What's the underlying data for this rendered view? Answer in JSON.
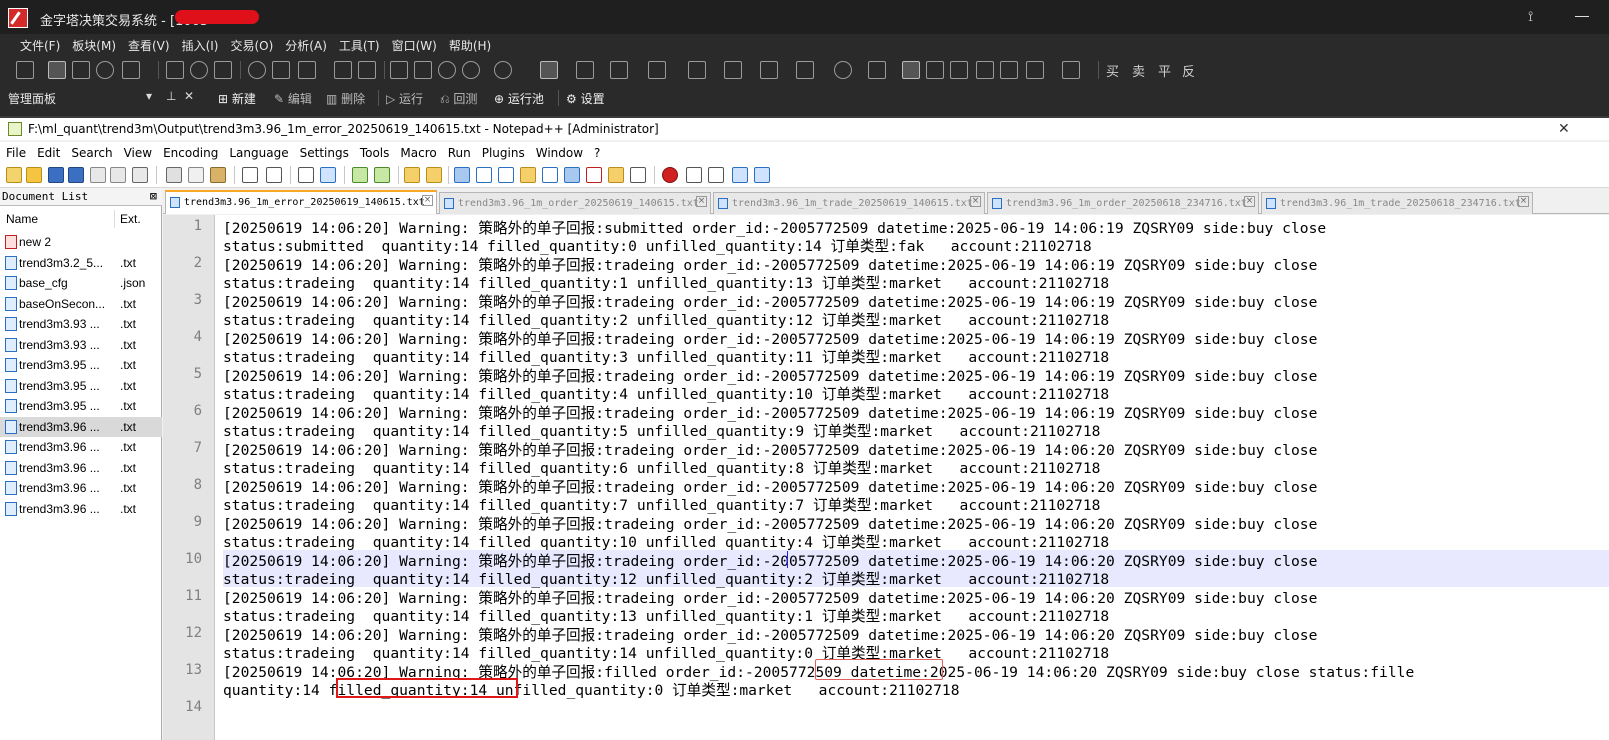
{
  "app": {
    "title": "金字塔决策交易系统 - [1063",
    "menu": [
      "文件(F)",
      "板块(M)",
      "查看(V)",
      "插入(I)",
      "交易(O)",
      "分析(A)",
      "工具(T)",
      "窗口(W)",
      "帮助(H)"
    ],
    "trade_buttons": [
      "买",
      "卖",
      "平",
      "反"
    ],
    "panel_title": "管理面板",
    "actions": {
      "new": "新建",
      "edit": "编辑",
      "delete": "删除",
      "run": "运行",
      "backtest": "回测",
      "pool": "运行池",
      "settings": "设置"
    }
  },
  "notepad": {
    "title": "F:\\ml_quant\\trend3m\\Output\\trend3m3.96_1m_error_20250619_140615.txt - Notepad++ [Administrator]",
    "menu": [
      "File",
      "Edit",
      "Search",
      "View",
      "Encoding",
      "Language",
      "Settings",
      "Tools",
      "Macro",
      "Run",
      "Plugins",
      "Window",
      "?"
    ],
    "doclist": {
      "header": "Document List",
      "col_name": "Name",
      "col_ext": "Ext.",
      "items": [
        {
          "name": "new 2",
          "ext": "",
          "icon": "unsaved-file-icon"
        },
        {
          "name": "trend3m3.2_5...",
          "ext": ".txt",
          "icon": "file-icon"
        },
        {
          "name": "base_cfg",
          "ext": ".json",
          "icon": "file-icon"
        },
        {
          "name": "baseOnSecon...",
          "ext": ".txt",
          "icon": "file-icon"
        },
        {
          "name": "trend3m3.93 ...",
          "ext": ".txt",
          "icon": "file-icon"
        },
        {
          "name": "trend3m3.93 ...",
          "ext": ".txt",
          "icon": "file-icon"
        },
        {
          "name": "trend3m3.95 ...",
          "ext": ".txt",
          "icon": "file-icon"
        },
        {
          "name": "trend3m3.95 ...",
          "ext": ".txt",
          "icon": "file-icon"
        },
        {
          "name": "trend3m3.95 ...",
          "ext": ".txt",
          "icon": "file-icon"
        },
        {
          "name": "trend3m3.96 ...",
          "ext": ".txt",
          "icon": "file-icon"
        },
        {
          "name": "trend3m3.96 ...",
          "ext": ".txt",
          "icon": "file-icon"
        },
        {
          "name": "trend3m3.96 ...",
          "ext": ".txt",
          "icon": "file-icon"
        },
        {
          "name": "trend3m3.96 ...",
          "ext": ".txt",
          "icon": "file-icon"
        },
        {
          "name": "trend3m3.96 ...",
          "ext": ".txt",
          "icon": "file-icon"
        }
      ],
      "selected_index": 9
    },
    "tabs": [
      {
        "label": "trend3m3.96_1m_error_20250619_140615.txt",
        "active": true
      },
      {
        "label": "trend3m3.96_1m_order_20250619_140615.txt",
        "active": false
      },
      {
        "label": "trend3m3.96_1m_trade_20250619_140615.txt",
        "active": false
      },
      {
        "label": "trend3m3.96_1m_order_20250618_234716.txt",
        "active": false
      },
      {
        "label": "trend3m3.96_1m_trade_20250618_234716.txt",
        "active": false
      }
    ],
    "current_line": 10,
    "lines": [
      {
        "n": "1",
        "a": "[20250619 14:06:20] Warning: 策略外的单子回报:submitted order_id:-2005772509 datetime:2025-06-19 14:06:19 ZQSRY09 side:buy close",
        "b": "status:submitted  quantity:14 filled_quantity:0 unfilled_quantity:14 订单类型:fak   account:21102718"
      },
      {
        "n": "2",
        "a": "[20250619 14:06:20] Warning: 策略外的单子回报:tradeing order_id:-2005772509 datetime:2025-06-19 14:06:19 ZQSRY09 side:buy close",
        "b": "status:tradeing  quantity:14 filled_quantity:1 unfilled_quantity:13 订单类型:market   account:21102718"
      },
      {
        "n": "3",
        "a": "[20250619 14:06:20] Warning: 策略外的单子回报:tradeing order_id:-2005772509 datetime:2025-06-19 14:06:19 ZQSRY09 side:buy close",
        "b": "status:tradeing  quantity:14 filled_quantity:2 unfilled_quantity:12 订单类型:market   account:21102718"
      },
      {
        "n": "4",
        "a": "[20250619 14:06:20] Warning: 策略外的单子回报:tradeing order_id:-2005772509 datetime:2025-06-19 14:06:19 ZQSRY09 side:buy close",
        "b": "status:tradeing  quantity:14 filled_quantity:3 unfilled_quantity:11 订单类型:market   account:21102718"
      },
      {
        "n": "5",
        "a": "[20250619 14:06:20] Warning: 策略外的单子回报:tradeing order_id:-2005772509 datetime:2025-06-19 14:06:19 ZQSRY09 side:buy close",
        "b": "status:tradeing  quantity:14 filled_quantity:4 unfilled_quantity:10 订单类型:market   account:21102718"
      },
      {
        "n": "6",
        "a": "[20250619 14:06:20] Warning: 策略外的单子回报:tradeing order_id:-2005772509 datetime:2025-06-19 14:06:19 ZQSRY09 side:buy close",
        "b": "status:tradeing  quantity:14 filled_quantity:5 unfilled_quantity:9 订单类型:market   account:21102718"
      },
      {
        "n": "7",
        "a": "[20250619 14:06:20] Warning: 策略外的单子回报:tradeing order_id:-2005772509 datetime:2025-06-19 14:06:20 ZQSRY09 side:buy close",
        "b": "status:tradeing  quantity:14 filled_quantity:6 unfilled_quantity:8 订单类型:market   account:21102718"
      },
      {
        "n": "8",
        "a": "[20250619 14:06:20] Warning: 策略外的单子回报:tradeing order_id:-2005772509 datetime:2025-06-19 14:06:20 ZQSRY09 side:buy close",
        "b": "status:tradeing  quantity:14 filled_quantity:7 unfilled_quantity:7 订单类型:market   account:21102718"
      },
      {
        "n": "9",
        "a": "[20250619 14:06:20] Warning: 策略外的单子回报:tradeing order_id:-2005772509 datetime:2025-06-19 14:06:20 ZQSRY09 side:buy close",
        "b": "status:tradeing  quantity:14 filled_quantity:10 unfilled_quantity:4 订单类型:market   account:21102718"
      },
      {
        "n": "10",
        "a": "[20250619 14:06:20] Warning: 策略外的单子回报:tradeing order_id:-2005772509 datetime:2025-06-19 14:06:20 ZQSRY09 side:buy close",
        "b": "status:tradeing  quantity:14 filled_quantity:12 unfilled_quantity:2 订单类型:market   account:21102718"
      },
      {
        "n": "11",
        "a": "[20250619 14:06:20] Warning: 策略外的单子回报:tradeing order_id:-2005772509 datetime:2025-06-19 14:06:20 ZQSRY09 side:buy close",
        "b": "status:tradeing  quantity:14 filled_quantity:13 unfilled_quantity:1 订单类型:market   account:21102718"
      },
      {
        "n": "12",
        "a": "[20250619 14:06:20] Warning: 策略外的单子回报:tradeing order_id:-2005772509 datetime:2025-06-19 14:06:20 ZQSRY09 side:buy close",
        "b": "status:tradeing  quantity:14 filled_quantity:14 unfilled_quantity:0 订单类型:market   account:21102718"
      },
      {
        "n": "13",
        "a": "[20250619 14:06:20] Warning: 策略外的单子回报:filled order_id:-2005772509 datetime:2025-06-19 14:06:20 ZQSRY09 side:buy close status:fille",
        "b": "quantity:14 filled_quantity:14 unfilled_quantity:0 订单类型:market   account:21102718"
      },
      {
        "n": "14",
        "a": "",
        "b": ""
      }
    ]
  },
  "colors": {
    "dark_bg": "#2a2a2a",
    "highlight_red": "#e01818",
    "current_line": "#e8e8ff",
    "gutter": "#e4e4e4"
  }
}
